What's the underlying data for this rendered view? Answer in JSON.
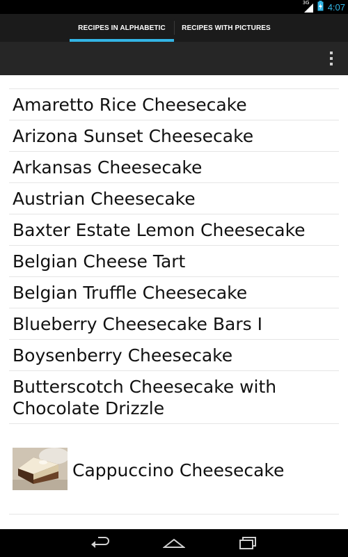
{
  "status_bar": {
    "network": "3G",
    "time": "4:07"
  },
  "tabs": [
    {
      "label": "RECIPES IN ALPHABETIC",
      "selected": true
    },
    {
      "label": "RECIPES WITH PICTURES",
      "selected": false
    }
  ],
  "recipes": [
    "Amaretto Rice Cheesecake",
    "Arizona Sunset Cheesecake",
    "Arkansas Cheesecake",
    "Austrian Cheesecake",
    "Baxter Estate Lemon Cheesecake",
    "Belgian Cheese Tart",
    "Belgian Truffle Cheesecake",
    "Blueberry Cheesecake Bars I",
    "Boysenberry Cheesecake",
    "Butterscotch Cheesecake with Chocolate Drizzle",
    "Cappuccino Cheesecake"
  ],
  "colors": {
    "accent": "#33b5e5",
    "tab_bar": "#1b1b1b",
    "action_bar": "#262626"
  },
  "icons": [
    "signal-icon",
    "battery-charging-icon",
    "overflow-menu-icon",
    "back-icon",
    "home-icon",
    "recent-apps-icon"
  ]
}
